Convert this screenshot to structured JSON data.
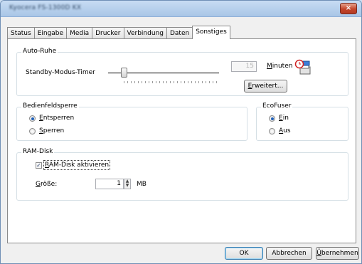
{
  "window": {
    "title": "Kyocera FS-1300D KX",
    "close": "×"
  },
  "tabs": [
    "Status",
    "Eingabe",
    "Media",
    "Drucker",
    "Verbindung",
    "Daten",
    "Sonstiges"
  ],
  "auto_ruhe": {
    "title": "Auto-Ruhe",
    "timer_label": "Standby-Modus-Timer",
    "value": "15",
    "unit": "Minuten",
    "advanced_button": "Erweitert..."
  },
  "bedienfeld": {
    "title": "Bedienfeldsperre",
    "options": [
      "Entsperren",
      "Sperren"
    ]
  },
  "ecofuser": {
    "title": "EcoFuser",
    "options": [
      "Ein",
      "Aus"
    ]
  },
  "ramdisk": {
    "title": "RAM-Disk",
    "enable_label": "RAM-Disk aktivieren",
    "size_label": "Größe:",
    "size_value": "1",
    "unit": "MB"
  },
  "footer": {
    "ok": "OK",
    "cancel": "Abbrechen",
    "apply": "Übernehmen"
  },
  "icons": [
    "clock-printer-icon",
    "close-icon",
    "spin-up-icon",
    "spin-down-icon"
  ]
}
